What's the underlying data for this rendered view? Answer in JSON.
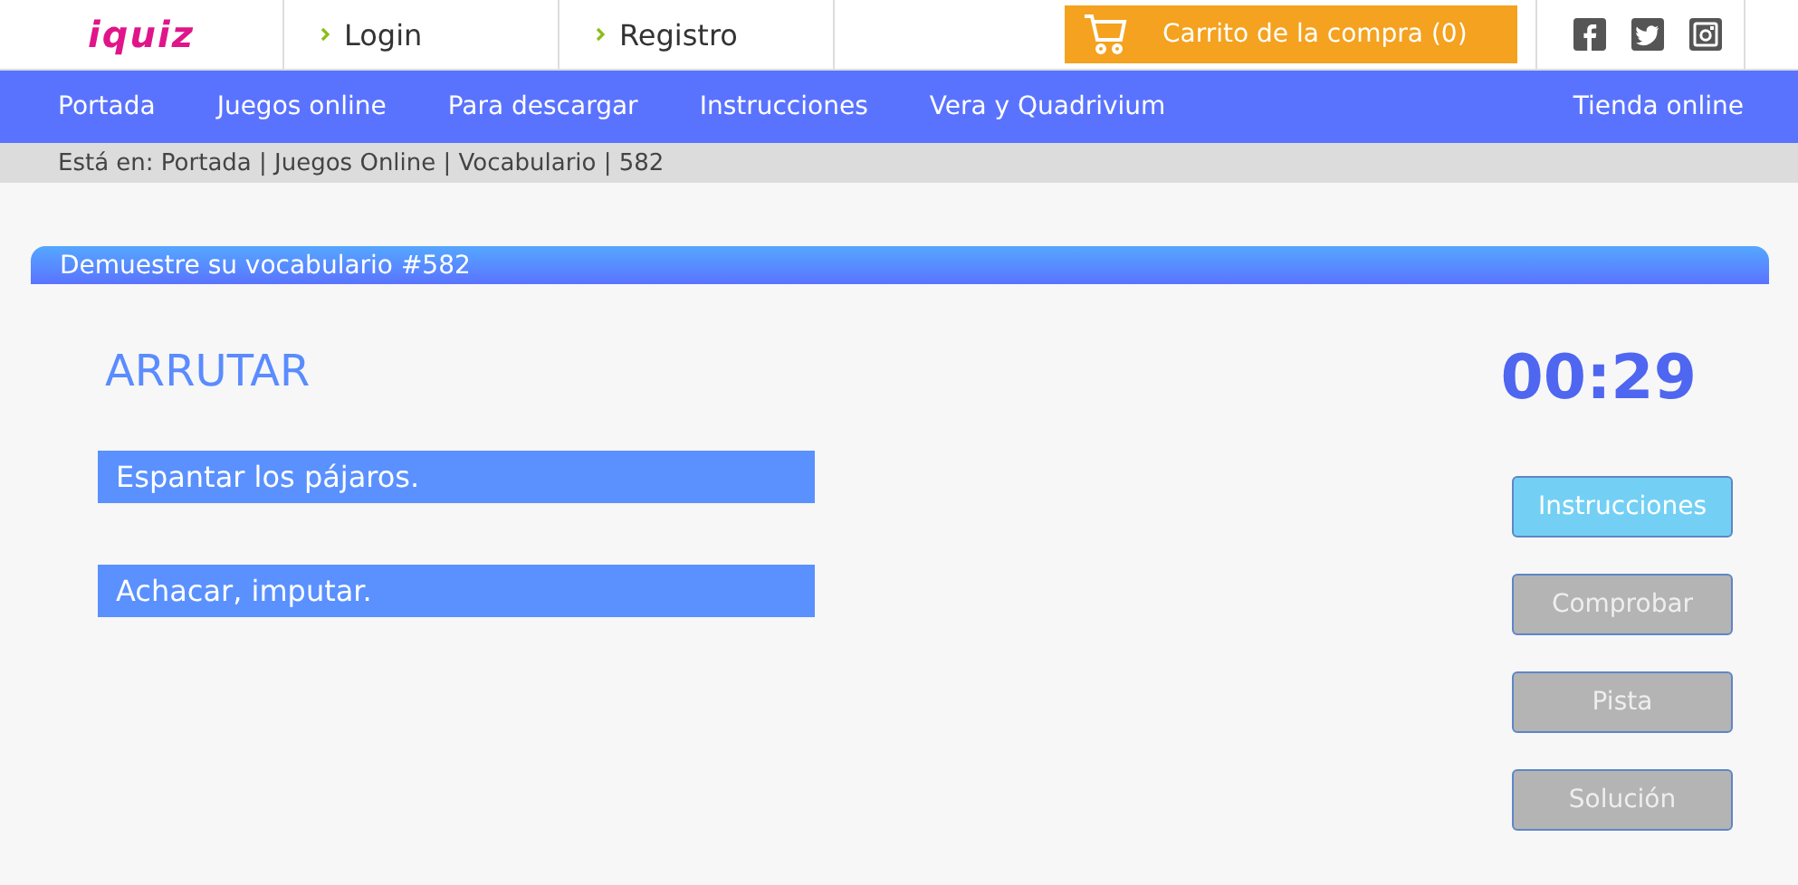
{
  "header": {
    "logo": "iquiz",
    "links": [
      "Login",
      "Registro"
    ],
    "cart": "Carrito de la compra (0)"
  },
  "nav": {
    "items": [
      "Portada",
      "Juegos online",
      "Para descargar",
      "Instrucciones",
      "Vera y Quadrivium"
    ],
    "right": "Tienda online"
  },
  "breadcrumb": "Está en: Portada | Juegos Online | Vocabulario | 582",
  "panel": {
    "title": "Demuestre su vocabulario #582",
    "word": "ARRUTAR",
    "timer": "00:29",
    "options": [
      "Espantar los pájaros.",
      "Achacar, imputar."
    ],
    "buttons": [
      {
        "label": "Instrucciones",
        "disabled": false
      },
      {
        "label": "Comprobar",
        "disabled": true
      },
      {
        "label": "Pista",
        "disabled": true
      },
      {
        "label": "Solución",
        "disabled": true
      }
    ]
  }
}
